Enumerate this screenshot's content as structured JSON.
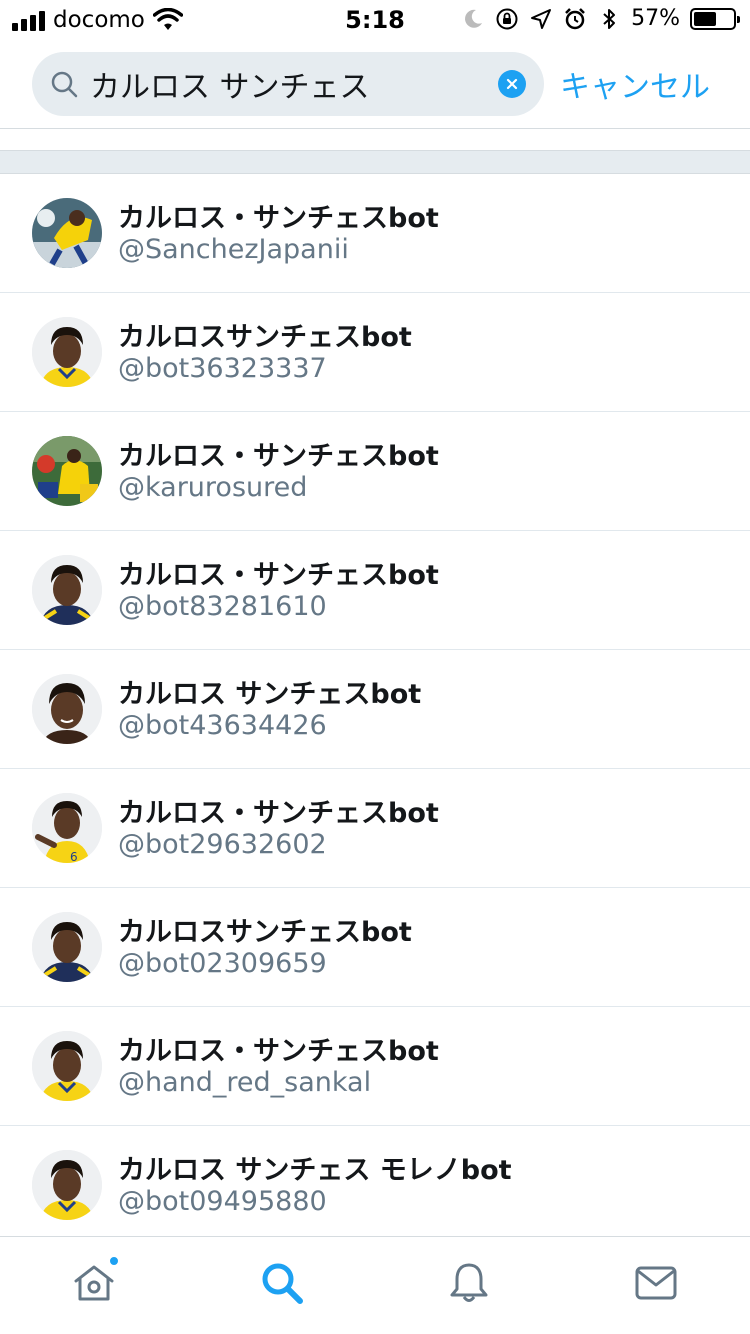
{
  "status_bar": {
    "carrier": "docomo",
    "time": "5:18",
    "battery_percent": "57%",
    "battery_level": 0.57
  },
  "search": {
    "query": "カルロス サンチェス",
    "cancel_label": "キャンセル"
  },
  "results": [
    {
      "name": "カルロス・サンチェスbot",
      "handle": "@SanchezJapanii",
      "avatar": "photo-action"
    },
    {
      "name": "カルロスサンチェスbot",
      "handle": "@bot36323337",
      "avatar": "portrait-yellow"
    },
    {
      "name": "カルロス・サンチェスbot",
      "handle": "@karurosured",
      "avatar": "photo-crowd"
    },
    {
      "name": "カルロス・サンチェスbot",
      "handle": "@bot83281610",
      "avatar": "portrait-navy"
    },
    {
      "name": "カルロス サンチェスbot",
      "handle": "@bot43634426",
      "avatar": "portrait-plain"
    },
    {
      "name": "カルロス・サンチェスbot",
      "handle": "@bot29632602",
      "avatar": "portrait-pointing"
    },
    {
      "name": "カルロスサンチェスbot",
      "handle": "@bot02309659",
      "avatar": "portrait-navy"
    },
    {
      "name": "カルロス・サンチェスbot",
      "handle": "@hand_red_sankal",
      "avatar": "portrait-yellow"
    },
    {
      "name": "カルロス サンチェス モレノbot",
      "handle": "@bot09495880",
      "avatar": "portrait-yellow"
    }
  ],
  "tabs": [
    {
      "name": "home",
      "icon": "home-icon",
      "badge": true
    },
    {
      "name": "search",
      "icon": "search-icon",
      "active": true
    },
    {
      "name": "notifications",
      "icon": "bell-icon"
    },
    {
      "name": "messages",
      "icon": "envelope-icon"
    }
  ],
  "colors": {
    "accent": "#1da1f2",
    "text_primary": "#14171a",
    "text_secondary": "#657786",
    "search_bg": "#e6ecf0",
    "tab_inactive": "#657786"
  }
}
